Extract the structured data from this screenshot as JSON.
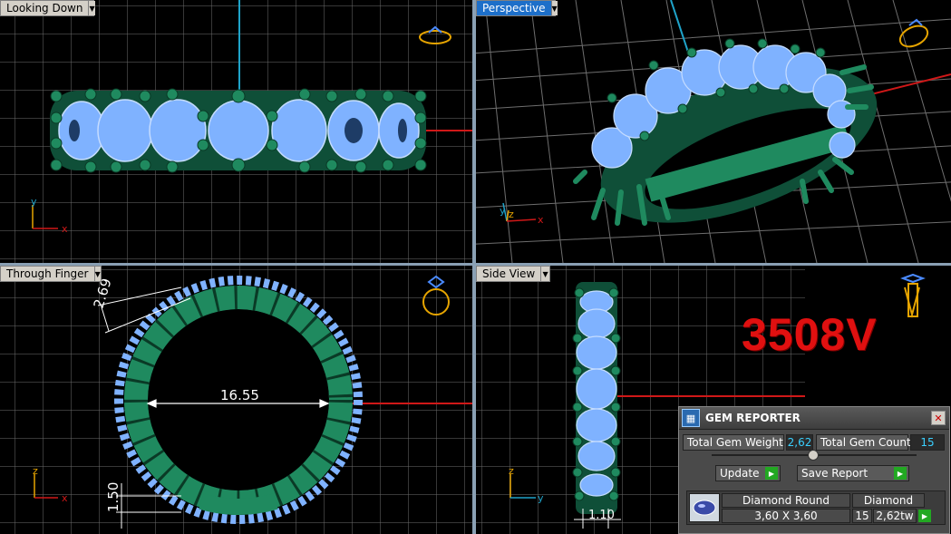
{
  "viewports": {
    "top_left": {
      "label": "Looking Down"
    },
    "top_right": {
      "label": "Perspective"
    },
    "bottom_left": {
      "label": "Through Finger"
    },
    "bottom_right": {
      "label": "Side View"
    }
  },
  "annotations": {
    "inner_diameter": "16.55",
    "ring_dim_a": "2.69",
    "ring_dim_b": "1.50",
    "side_dim": "1.10"
  },
  "axes": {
    "x": "x",
    "y": "y",
    "z": "z"
  },
  "model_code": "3508V",
  "gem_reporter": {
    "title": "GEM REPORTER",
    "close": "✕",
    "weight_label": "Total Gem Weight",
    "weight_value": "2,62",
    "count_label": "Total Gem Count",
    "count_value": "15",
    "update_label": "Update",
    "save_label": "Save Report",
    "table": {
      "shape": "Diamond Round",
      "material": "Diamond",
      "size": "3,60 X 3,60",
      "count": "15",
      "weight": "2,62tw"
    }
  },
  "colors": {
    "grid": "#7a7a7a",
    "gem": "#7fb2ff",
    "metal": "#1f8a5f",
    "axis_red": "#d01818",
    "axis_cyan": "#1fa3c9",
    "model_code": "#e01010",
    "value_text": "#3ad0ff"
  }
}
